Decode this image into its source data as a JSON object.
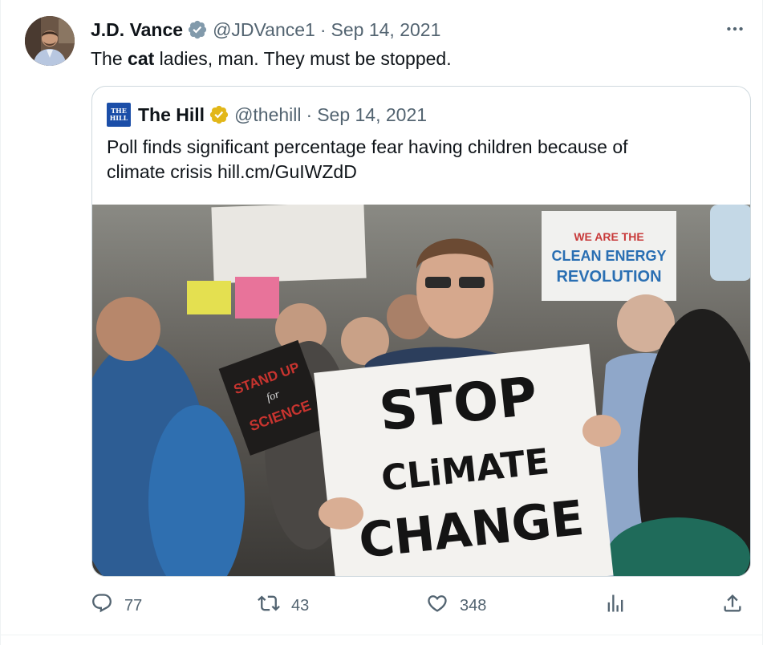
{
  "tweet": {
    "author_name": "J.D. Vance",
    "author_handle": "@JDVance1",
    "separator": "·",
    "date": "Sep 14, 2021",
    "text_before": "The ",
    "text_bold": "cat",
    "text_after": " ladies, man. They must be stopped.",
    "verified_color": "#829aab",
    "more_icon": "ellipsis-icon"
  },
  "quoted": {
    "logo_text_1": "THE",
    "logo_text_2": "HILL",
    "author_name": "The Hill",
    "author_handle": "@thehill",
    "separator": "·",
    "date": "Sep 14, 2021",
    "text_line1": "Poll finds significant percentage fear having children because of",
    "text_line2": "climate crisis hill.cm/GuIWZdD",
    "verified_color": "#e2b719",
    "image": {
      "sign_text_1": "STOP",
      "sign_text_2": "CLiMATE",
      "sign_text_3": "CHANGE",
      "sign_small_1": "STAND UP",
      "sign_small_2": "for",
      "sign_small_3": "SCIENCE",
      "sign_back_1": "WE ARE THE",
      "sign_back_2": "CLEAN ENERGY",
      "sign_back_3": "REVOLUTION"
    }
  },
  "actions": {
    "reply_count": "77",
    "retweet_count": "43",
    "like_count": "348",
    "icons": [
      "reply-icon",
      "retweet-icon",
      "like-icon",
      "views-icon",
      "share-icon"
    ]
  },
  "colors": {
    "text": "#0f1419",
    "secondary": "#536471",
    "border": "#cfd9de"
  }
}
